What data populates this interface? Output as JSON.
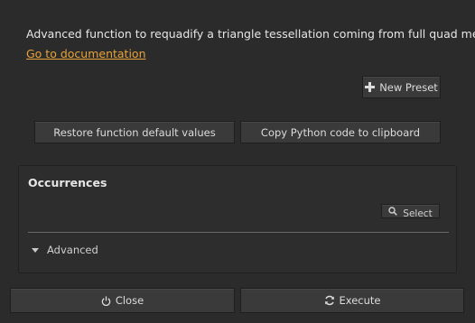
{
  "description": "Advanced function to requadify a triangle tessellation coming from full quad mesh",
  "documentation_link": "Go to documentation",
  "new_preset_label": "New Preset",
  "restore_label": "Restore function default values",
  "copy_python_label": "Copy Python code to clipboard",
  "occurrences": {
    "title": "Occurrences",
    "select_label": "Select"
  },
  "advanced_label": "Advanced",
  "footer": {
    "close_label": "Close",
    "execute_label": "Execute"
  },
  "colors": {
    "background": "#2b2b2b",
    "link": "#e8a33a",
    "button": "#3a3a3a"
  },
  "icons": [
    "plus-icon",
    "search-icon",
    "triangle-down-icon",
    "power-icon",
    "refresh-icon"
  ]
}
